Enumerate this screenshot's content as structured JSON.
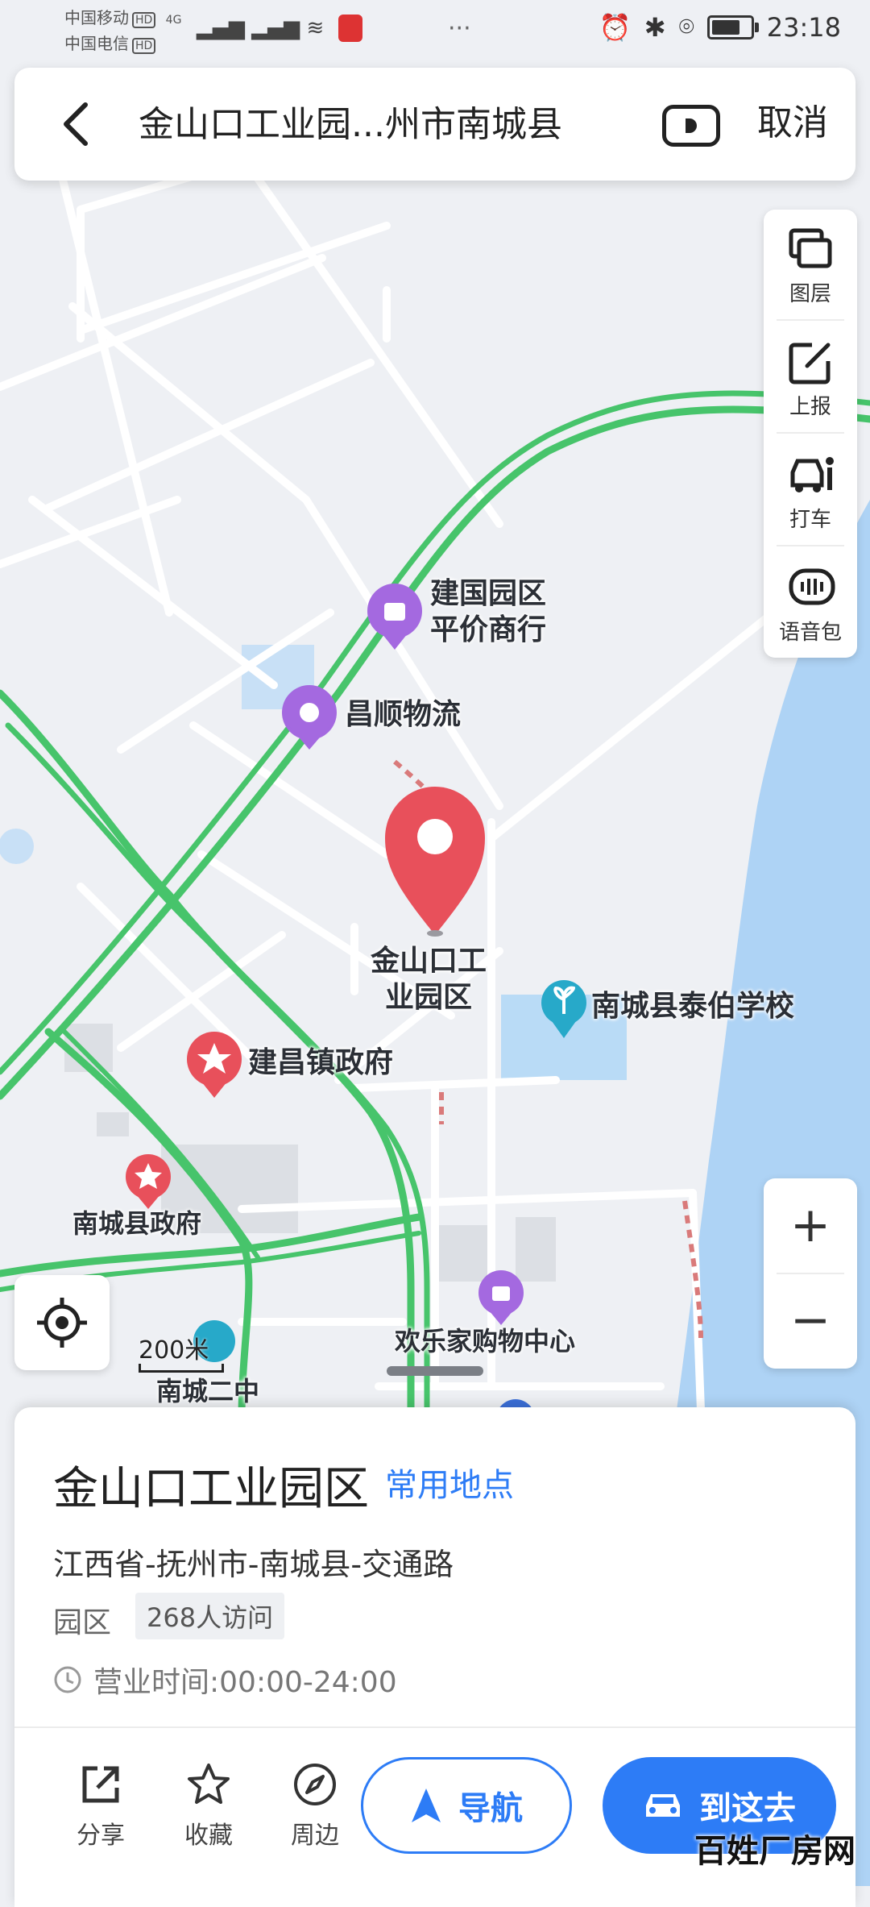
{
  "status_bar": {
    "carrier_1": "中国移动",
    "carrier_2": "中国电信",
    "hd": "HD",
    "network": "4G",
    "time": "23:18"
  },
  "search": {
    "query": "金山口工业园...州市南城县",
    "cancel": "取消",
    "back_icon": "back-arrow-icon",
    "voice_icon": "voice-input-icon"
  },
  "toolbox": {
    "items": [
      {
        "label": "图层",
        "icon": "layers-icon"
      },
      {
        "label": "上报",
        "icon": "report-edit-icon"
      },
      {
        "label": "打车",
        "icon": "taxi-icon"
      },
      {
        "label": "语音包",
        "icon": "voice-pack-icon"
      }
    ]
  },
  "zoom": {
    "in": "+",
    "out": "−"
  },
  "scale": {
    "label": "200米"
  },
  "map": {
    "labels": {
      "jianguo": "建国园区\n平价商行",
      "changshun": "昌顺物流",
      "selected": "金山口工\n业园区",
      "taibo_school": "南城县泰伯学校",
      "jianchang_gov": "建昌镇政府",
      "county_gov": "南城县政府",
      "mall": "欢乐家购物中心",
      "school2": "南城二中"
    },
    "colors": {
      "road_green": "#47c46b",
      "water": "#aed3f5",
      "pin_red": "#e8505b",
      "pin_purple": "#a469e0",
      "pin_teal": "#27a9c9"
    }
  },
  "card": {
    "title": "金山口工业园区",
    "tag": "常用地点",
    "address": "江西省-抚州市-南城县-交通路",
    "category": "园区",
    "visits": "268人访问",
    "hours": "营业时间:00:00-24:00",
    "actions": [
      {
        "label": "分享",
        "icon": "share-icon"
      },
      {
        "label": "收藏",
        "icon": "star-icon"
      },
      {
        "label": "周边",
        "icon": "compass-icon"
      }
    ],
    "navigate": "导航",
    "go_here": "到这去",
    "accent": "#2d7cf6"
  },
  "watermark": "百姓厂房网"
}
